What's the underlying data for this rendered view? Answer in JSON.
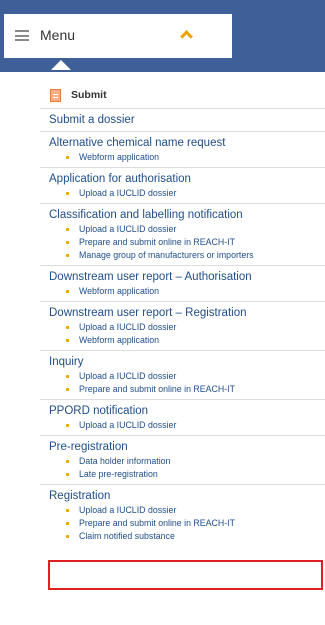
{
  "header": {
    "menu_label": "Menu"
  },
  "section": {
    "title": "Submit"
  },
  "categories": [
    {
      "title": "Submit a dossier",
      "subs": []
    },
    {
      "title": "Alternative chemical name request",
      "subs": [
        "Webform application"
      ]
    },
    {
      "title": "Application for authorisation",
      "subs": [
        "Upload a IUCLID dossier"
      ]
    },
    {
      "title": "Classification and labelling notification",
      "subs": [
        "Upload a IUCLID dossier",
        "Prepare and submit online in REACH-IT",
        "Manage group of manufacturers or importers"
      ]
    },
    {
      "title": "Downstream user report – Authorisation",
      "subs": [
        "Webform application"
      ]
    },
    {
      "title": "Downstream user report – Registration",
      "subs": [
        "Upload a IUCLID dossier",
        "Webform application"
      ]
    },
    {
      "title": "Inquiry",
      "subs": [
        "Upload a IUCLID dossier",
        "Prepare and submit online in REACH-IT"
      ]
    },
    {
      "title": "PPORD notification",
      "subs": [
        "Upload a IUCLID dossier"
      ]
    },
    {
      "title": "Pre-registration",
      "subs": [
        "Data holder information",
        "Late pre-registration"
      ]
    },
    {
      "title": "Registration",
      "subs": [
        "Upload a IUCLID dossier",
        "Prepare and submit online in REACH-IT",
        "Claim notified substance"
      ]
    }
  ],
  "colors": {
    "topbar": "#3f5f99",
    "link": "#1f4e89",
    "bullet": "#f0a000",
    "highlight_border": "#e02020"
  }
}
